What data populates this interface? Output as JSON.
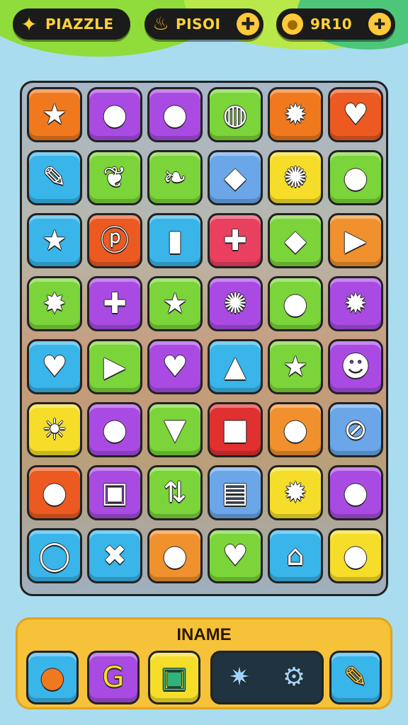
{
  "hud": {
    "puzzle": {
      "label": "PIAZZLE",
      "icon": "puzzle-star-icon"
    },
    "coins": {
      "label": "PISOI",
      "icon": "flame-icon",
      "action_icon": "plus-icon"
    },
    "score": {
      "label": "9R10",
      "icon": "coin-icon",
      "action_icon": "plus-icon"
    }
  },
  "board": {
    "rows": [
      [
        {
          "icon": "star-icon",
          "color": "#f0791e",
          "glyph": "★"
        },
        {
          "icon": "drop-icon",
          "color": "#a94be3",
          "glyph": "●"
        },
        {
          "icon": "orange-ball-icon",
          "color": "#a94be3",
          "glyph": "●"
        },
        {
          "icon": "striped-ball-icon",
          "color": "#7bd43a",
          "glyph": "◍"
        },
        {
          "icon": "gear-face-icon",
          "color": "#f0791e",
          "glyph": "✹"
        },
        {
          "icon": "heart-box-icon",
          "color": "#ec5a22",
          "glyph": "♥"
        }
      ],
      [
        {
          "icon": "clip-icon",
          "color": "#39b5ea",
          "glyph": "✎"
        },
        {
          "icon": "leaf-icon",
          "color": "#7bd43a",
          "glyph": "❦"
        },
        {
          "icon": "leaf-green-icon",
          "color": "#7bd43a",
          "glyph": "❧"
        },
        {
          "icon": "diamond-icon",
          "color": "#6aa6e8",
          "glyph": "◆"
        },
        {
          "icon": "blue-gear-icon",
          "color": "#f5dd2a",
          "glyph": "✺"
        },
        {
          "icon": "cherry-icon",
          "color": "#7bd43a",
          "glyph": "●"
        }
      ],
      [
        {
          "icon": "rainbow-star-icon",
          "color": "#39b5ea",
          "glyph": "★"
        },
        {
          "icon": "p-ring-icon",
          "color": "#ec5a22",
          "glyph": "ⓟ"
        },
        {
          "icon": "block-icon",
          "color": "#39b5ea",
          "glyph": "▮"
        },
        {
          "icon": "red-clover-icon",
          "color": "#e94060",
          "glyph": "✚"
        },
        {
          "icon": "blue-gem-icon",
          "color": "#7bd43a",
          "glyph": "◆"
        },
        {
          "icon": "play-icon",
          "color": "#f0912e",
          "glyph": "▶"
        }
      ],
      [
        {
          "icon": "star-face-icon",
          "color": "#7bd43a",
          "glyph": "✸"
        },
        {
          "icon": "purple-clover-icon",
          "color": "#a94be3",
          "glyph": "✚"
        },
        {
          "icon": "yellow-star-icon",
          "color": "#7bd43a",
          "glyph": "★"
        },
        {
          "icon": "sun-face-icon",
          "color": "#a94be3",
          "glyph": "✺"
        },
        {
          "icon": "plum-icon",
          "color": "#7bd43a",
          "glyph": "●"
        },
        {
          "icon": "gear-face-icon",
          "color": "#a94be3",
          "glyph": "✹"
        }
      ],
      [
        {
          "icon": "heart-icon",
          "color": "#39b5ea",
          "glyph": "♥"
        },
        {
          "icon": "triangle-icon",
          "color": "#7bd43a",
          "glyph": "▶"
        },
        {
          "icon": "purple-heart-icon",
          "color": "#a94be3",
          "glyph": "♥"
        },
        {
          "icon": "bottle-icon",
          "color": "#39b5ea",
          "glyph": "▲"
        },
        {
          "icon": "gold-star-icon",
          "color": "#7bd43a",
          "glyph": "★"
        },
        {
          "icon": "monster-face-icon",
          "color": "#a94be3",
          "glyph": "☻"
        }
      ],
      [
        {
          "icon": "sun-icon",
          "color": "#f5dd2a",
          "glyph": "☀"
        },
        {
          "icon": "blue-drop-icon",
          "color": "#a94be3",
          "glyph": "●"
        },
        {
          "icon": "ice-cream-icon",
          "color": "#7bd43a",
          "glyph": "▼"
        },
        {
          "icon": "box-icon",
          "color": "#e03030",
          "glyph": "■"
        },
        {
          "icon": "balloon-icon",
          "color": "#f0912e",
          "glyph": "●"
        },
        {
          "icon": "compass-icon",
          "color": "#6aa6e8",
          "glyph": "⊘"
        }
      ],
      [
        {
          "icon": "blue-orb-icon",
          "color": "#ec5a22",
          "glyph": "●"
        },
        {
          "icon": "monitor-icon",
          "color": "#a94be3",
          "glyph": "▣"
        },
        {
          "icon": "arrows-icon",
          "color": "#7bd43a",
          "glyph": "⇅"
        },
        {
          "icon": "browser-icon",
          "color": "#6aa6e8",
          "glyph": "▤"
        },
        {
          "icon": "white-gear-icon",
          "color": "#f5dd2a",
          "glyph": "✹"
        },
        {
          "icon": "teal-orb-icon",
          "color": "#a94be3",
          "glyph": "●"
        }
      ],
      [
        {
          "icon": "ring-icon",
          "color": "#39b5ea",
          "glyph": "◯"
        },
        {
          "icon": "green-x-icon",
          "color": "#39b5ea",
          "glyph": "✖"
        },
        {
          "icon": "red-balloon-icon",
          "color": "#f0912e",
          "glyph": "●"
        },
        {
          "icon": "green-heart-icon",
          "color": "#7bd43a",
          "glyph": "♥"
        },
        {
          "icon": "house-icon",
          "color": "#39b5ea",
          "glyph": "⌂"
        },
        {
          "icon": "red-fruit-icon",
          "color": "#f5dd2a",
          "glyph": "●"
        }
      ]
    ]
  },
  "panel": {
    "title": "INAME",
    "items": [
      {
        "icon": "orange-fruit-icon",
        "color": "#39b5ea",
        "glyph": "●",
        "glyph_color": "#f0791e"
      },
      {
        "icon": "g-swirl-icon",
        "color": "#a94be3",
        "glyph": "G",
        "glyph_color": "#f5dd2a"
      },
      {
        "icon": "photo-icon",
        "color": "#f5dd2a",
        "glyph": "▣",
        "glyph_color": "#2fb37a"
      },
      {
        "icon": "pencil-icon",
        "color": "#39b5ea",
        "glyph": "✎",
        "glyph_color": "#f5c43a"
      }
    ],
    "dark_items": [
      {
        "icon": "shield-gear-icon",
        "glyph": "✷"
      },
      {
        "icon": "settings-gear-icon",
        "glyph": "⚙"
      }
    ]
  }
}
